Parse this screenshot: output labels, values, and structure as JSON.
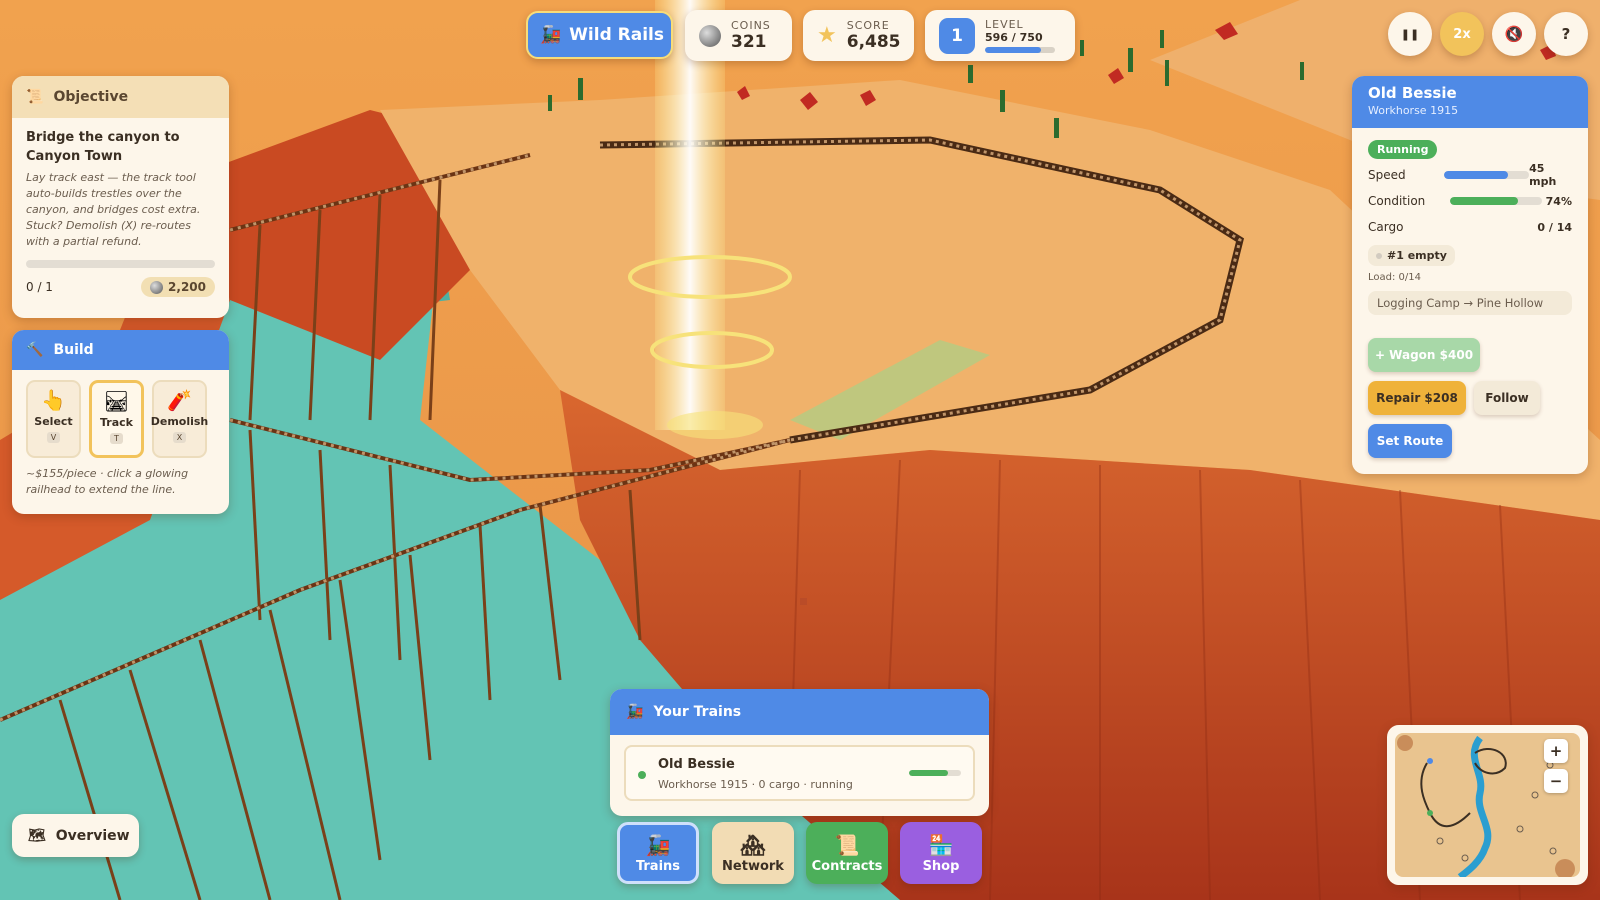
{
  "topbar": {
    "brand": "Wild Rails",
    "coins_label": "COINS",
    "coins_value": "321",
    "score_label": "SCORE",
    "score_value": "6,485",
    "level_number": "1",
    "level_label": "LEVEL",
    "level_xp": "596 / 750",
    "level_progress": 0.795
  },
  "controls": {
    "pause": "❚❚",
    "speed": "2x",
    "help": "?"
  },
  "objective": {
    "header": "Objective",
    "title": "Bridge the canyon to Canyon Town",
    "description": "Lay track east — the track tool auto-builds trestles over the canyon, and bridges cost extra. Stuck? Demolish (X) re-routes with a partial refund.",
    "progress_text": "0 / 1",
    "progress": 0,
    "reward": "2,200"
  },
  "build": {
    "header": "Build",
    "tools": [
      {
        "label": "Select",
        "key": "V",
        "icon": "pointer-hand-icon"
      },
      {
        "label": "Track",
        "key": "T",
        "icon": "track-icon"
      },
      {
        "label": "Demolish",
        "key": "X",
        "icon": "dynamite-icon"
      }
    ],
    "active_tool": "Track",
    "note": "~$155/piece · click a glowing railhead to extend the line."
  },
  "train_details": {
    "name": "Old Bessie",
    "subtitle": "Workhorse 1915",
    "status": "Running",
    "speed_label": "Speed",
    "speed_value": "45 mph",
    "speed_fraction": 0.75,
    "condition_label": "Condition",
    "condition_value": "74%",
    "condition_fraction": 0.74,
    "cargo_label": "Cargo",
    "cargo_value": "0 / 14",
    "slot": "#1 empty",
    "load": "Load: 0/14",
    "route": "Logging Camp → Pine Hollow",
    "wagon_button": "+ Wagon $400",
    "repair_button": "Repair $208",
    "follow_button": "Follow",
    "set_route_button": "Set Route"
  },
  "your_trains": {
    "header": "Your Trains",
    "items": [
      {
        "name": "Old Bessie",
        "subtitle": "Workhorse 1915 · 0 cargo · running",
        "progress": 0.75
      }
    ]
  },
  "tabs": [
    {
      "label": "Trains",
      "icon": "locomotive-icon",
      "color": "#4f8ae6"
    },
    {
      "label": "Network",
      "icon": "stations-icon",
      "color": "#f2dcb4"
    },
    {
      "label": "Contracts",
      "icon": "scroll-icon",
      "color": "#4caf5a"
    },
    {
      "label": "Shop",
      "icon": "shop-icon",
      "color": "#9a5fe0"
    }
  ],
  "overview_button": "Overview",
  "minimap": {
    "zoom_in": "+",
    "zoom_out": "−"
  },
  "colors": {
    "accent_blue": "#4f8ae6",
    "gold": "#f2c35b",
    "green": "#4caf5a",
    "purple": "#9a5fe0",
    "water": "#63c4b4",
    "mesa": "#f0b26b"
  }
}
